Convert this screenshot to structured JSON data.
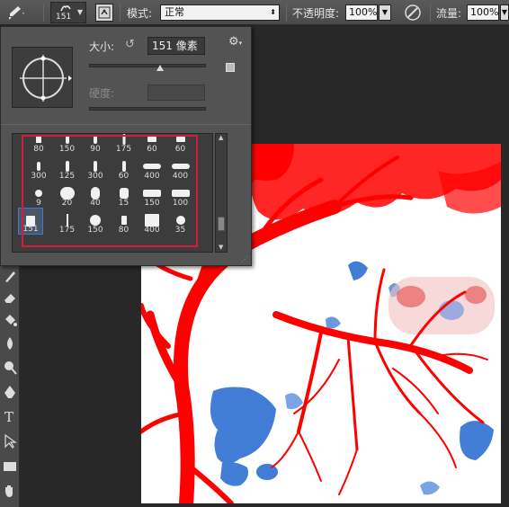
{
  "options_bar": {
    "brush_size": "151",
    "mode_label": "模式:",
    "mode_value": "正常",
    "opacity_label": "不透明度:",
    "opacity_value": "100%",
    "flow_label": "流量:",
    "flow_value": "100%"
  },
  "brush_panel": {
    "size_label": "大小:",
    "size_value": "151 像素",
    "hardness_label": "硬度:",
    "presets": [
      [
        "80",
        "150",
        "90",
        "175",
        "60",
        "60"
      ],
      [
        "300",
        "125",
        "300",
        "60",
        "400",
        "400"
      ],
      [
        "9",
        "20",
        "40",
        "15",
        "150",
        "100"
      ],
      [
        "151",
        "175",
        "150",
        "80",
        "400",
        "35"
      ]
    ],
    "selected_preset": "151"
  },
  "colors": {
    "selection_border": "#d21e3c",
    "tree_red": "#ff0000",
    "smudge_blue": "#2e6fd1"
  }
}
